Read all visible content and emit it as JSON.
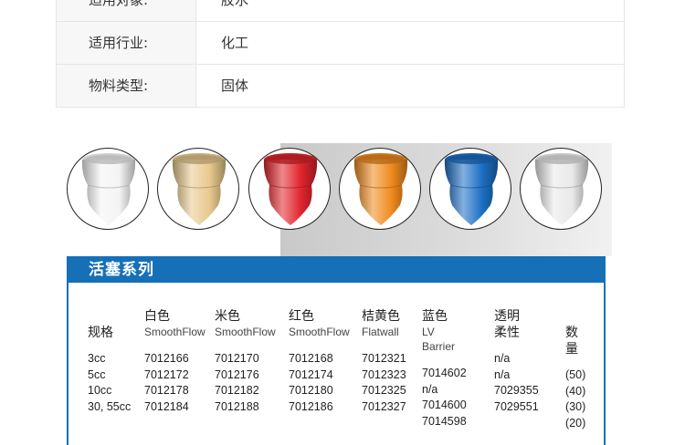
{
  "attributes": [
    {
      "key": "适用对象:",
      "value": "胶水"
    },
    {
      "key": "适用行业:",
      "value": "化工"
    },
    {
      "key": "物料类型:",
      "value": "固体"
    }
  ],
  "series_title": "活塞系列",
  "colors": {
    "header_blue": "#1570b8",
    "cap_white": "#f4f4f4",
    "cap_beige": "#e8c98e",
    "cap_red": "#e0242c",
    "cap_orange": "#f08a1e",
    "cap_blue": "#1c6fc4",
    "cap_clear": "#e9e9e9"
  },
  "table": {
    "columns": [
      {
        "cn": "规格",
        "en": ""
      },
      {
        "cn": "白色",
        "en": "SmoothFlow"
      },
      {
        "cn": "米色",
        "en": "SmoothFlow"
      },
      {
        "cn": "红色",
        "en": "SmoothFlow"
      },
      {
        "cn": "桔黄色",
        "en": "Flatwall"
      },
      {
        "cn": "蓝色",
        "en": "LV Barrier"
      },
      {
        "cn": "透明",
        "en": "柔性"
      },
      {
        "cn": "数量",
        "en": ""
      }
    ],
    "rows": [
      [
        "3cc",
        "7012166",
        "7012170",
        "7012168",
        "7012321",
        "7014602",
        "n/a",
        "(50)"
      ],
      [
        "5cc",
        "7012172",
        "7012176",
        "7012174",
        "7012323",
        "n/a",
        "n/a",
        "(40)"
      ],
      [
        "10cc",
        "7012178",
        "7012182",
        "7012180",
        "7012325",
        "7014600",
        "7029355",
        "(30)"
      ],
      [
        "30, 55cc",
        "7012184",
        "7012188",
        "7012186",
        "7012327",
        "7014598",
        "7029551",
        "(20)"
      ]
    ]
  }
}
